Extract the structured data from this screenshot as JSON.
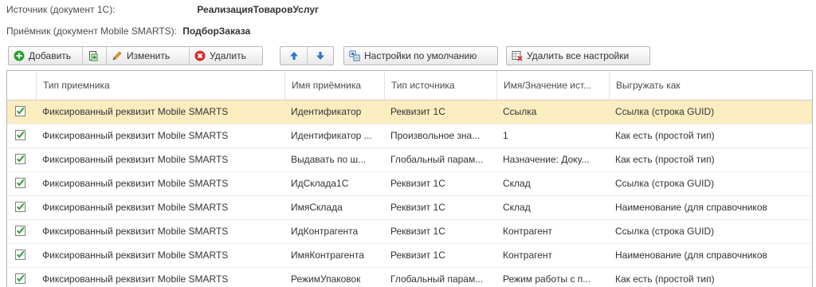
{
  "source": {
    "label": "Источник (документ 1С):",
    "value": "РеализацияТоваровУслуг"
  },
  "receiver": {
    "label": "Приёмник (документ Mobile SMARTS):",
    "value": "ПодборЗаказа"
  },
  "toolbar": {
    "add_label": "Добавить",
    "edit_label": "Изменить",
    "delete_label": "Удалить",
    "defaults_label": "Настройки по умолчанию",
    "delete_all_label": "Удалить все настройки"
  },
  "colors": {
    "selected_row": "#fbedc0",
    "check_green": "#2f9a2f",
    "add_icon": "#2e9e2e",
    "delete_icon": "#d32f2f",
    "arrow_icon": "#2f73c6"
  },
  "table": {
    "columns": [
      "Тип приемника",
      "Имя приёмника",
      "Тип источника",
      "Имя/Значение ист...",
      "Выгружать как"
    ],
    "rows": [
      {
        "checked": true,
        "selected": true,
        "cells": [
          "Фиксированный реквизит Mobile SMARTS",
          "Идентификатор",
          "Реквизит 1С",
          "Ссылка",
          "Ссылка (строка GUID)"
        ]
      },
      {
        "checked": true,
        "selected": false,
        "cells": [
          "Фиксированный реквизит Mobile SMARTS",
          "Идентификатор ...",
          "Произвольное зна...",
          "1",
          "Как есть (простой тип)"
        ]
      },
      {
        "checked": true,
        "selected": false,
        "cells": [
          "Фиксированный реквизит Mobile SMARTS",
          "Выдавать по ш...",
          "Глобальный парам...",
          "Назначение: Доку...",
          "Как есть (простой тип)"
        ]
      },
      {
        "checked": true,
        "selected": false,
        "cells": [
          "Фиксированный реквизит Mobile SMARTS",
          "ИдСклада1С",
          "Реквизит 1С",
          "Склад",
          "Ссылка (строка GUID)"
        ]
      },
      {
        "checked": true,
        "selected": false,
        "cells": [
          "Фиксированный реквизит Mobile SMARTS",
          "ИмяСклада",
          "Реквизит 1С",
          "Склад",
          "Наименование (для справочников"
        ]
      },
      {
        "checked": true,
        "selected": false,
        "cells": [
          "Фиксированный реквизит Mobile SMARTS",
          "ИдКонтрагента",
          "Реквизит 1С",
          "Контрагент",
          "Ссылка (строка GUID)"
        ]
      },
      {
        "checked": true,
        "selected": false,
        "cells": [
          "Фиксированный реквизит Mobile SMARTS",
          "ИмяКонтрагента",
          "Реквизит 1С",
          "Контрагент",
          "Наименование (для справочников"
        ]
      },
      {
        "checked": true,
        "selected": false,
        "cells": [
          "Фиксированный реквизит Mobile SMARTS",
          "РежимУпаковок",
          "Глобальный парам...",
          "Режим работы с п...",
          "Как есть (простой тип)"
        ]
      }
    ]
  }
}
